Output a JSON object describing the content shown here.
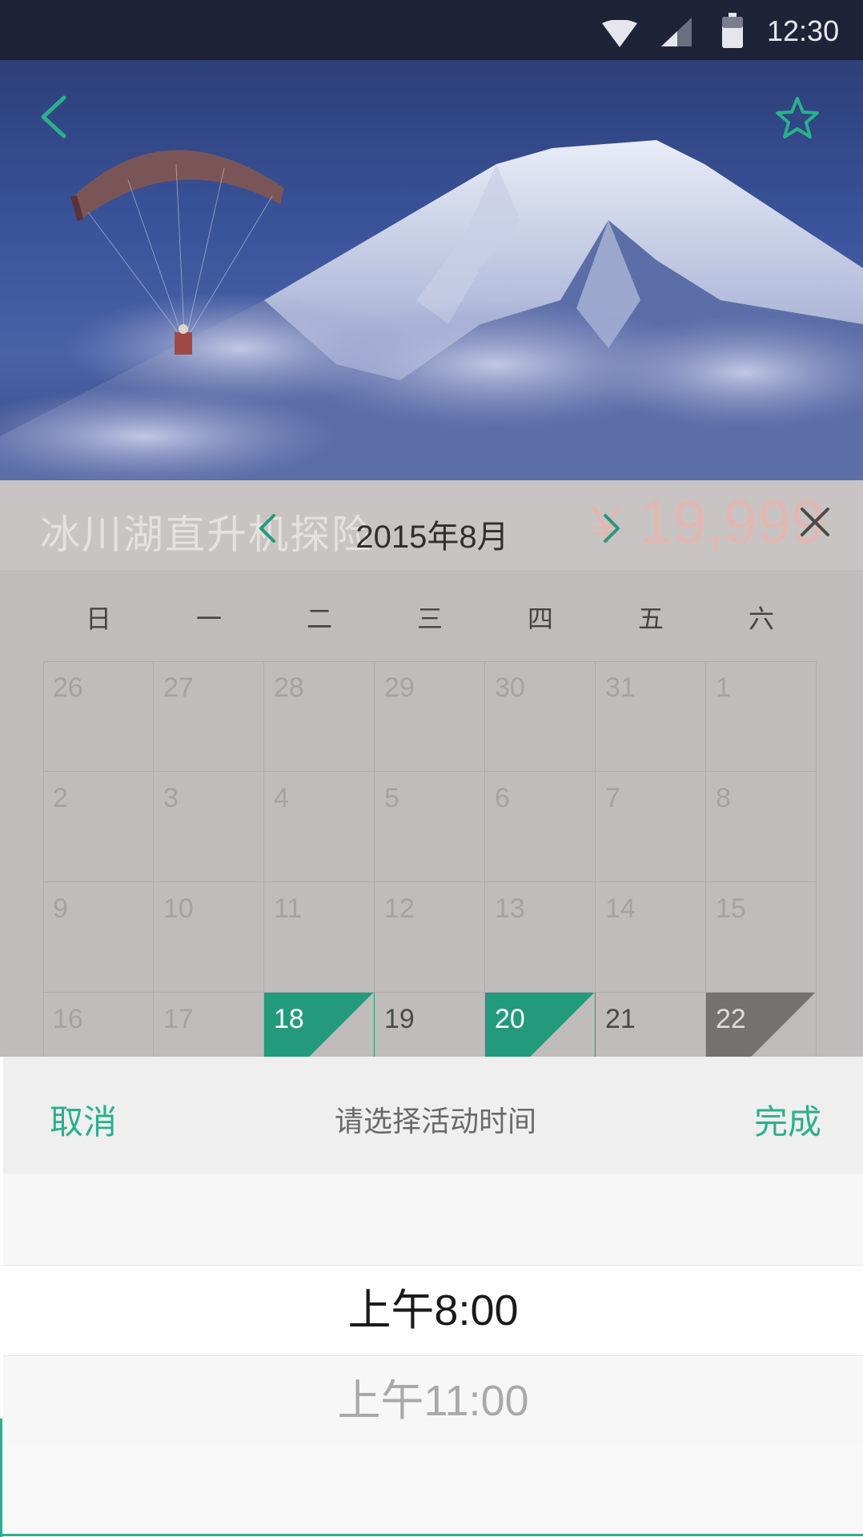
{
  "status_bar": {
    "time": "12:30",
    "icons": [
      "wifi-icon",
      "cell-signal-icon",
      "battery-icon"
    ]
  },
  "header": {
    "back_icon": "chevron-left-icon",
    "favorite_icon": "star-icon"
  },
  "activity": {
    "title": "冰川湖直升机探险",
    "currency": "￥",
    "price": "19,999"
  },
  "calendar": {
    "month_label": "2015年8月",
    "prev_icon": "chevron-left-icon",
    "next_icon": "chevron-right-icon",
    "close_icon": "close-icon",
    "weekdays": [
      "日",
      "一",
      "二",
      "三",
      "四",
      "五",
      "六"
    ],
    "weeks": [
      [
        {
          "d": "26",
          "s": "disabled"
        },
        {
          "d": "27",
          "s": "disabled"
        },
        {
          "d": "28",
          "s": "disabled"
        },
        {
          "d": "29",
          "s": "disabled"
        },
        {
          "d": "30",
          "s": "disabled"
        },
        {
          "d": "31",
          "s": "disabled"
        },
        {
          "d": "1",
          "s": "disabled"
        }
      ],
      [
        {
          "d": "2",
          "s": "disabled"
        },
        {
          "d": "3",
          "s": "disabled"
        },
        {
          "d": "4",
          "s": "disabled"
        },
        {
          "d": "5",
          "s": "disabled"
        },
        {
          "d": "6",
          "s": "disabled"
        },
        {
          "d": "7",
          "s": "disabled"
        },
        {
          "d": "8",
          "s": "disabled"
        }
      ],
      [
        {
          "d": "9",
          "s": "disabled"
        },
        {
          "d": "10",
          "s": "disabled"
        },
        {
          "d": "11",
          "s": "disabled"
        },
        {
          "d": "12",
          "s": "disabled"
        },
        {
          "d": "13",
          "s": "disabled"
        },
        {
          "d": "14",
          "s": "disabled"
        },
        {
          "d": "15",
          "s": "disabled"
        }
      ],
      [
        {
          "d": "16",
          "s": "disabled"
        },
        {
          "d": "17",
          "s": "disabled"
        },
        {
          "d": "18",
          "s": "selected"
        },
        {
          "d": "19",
          "s": "available"
        },
        {
          "d": "20",
          "s": "selected"
        },
        {
          "d": "21",
          "s": "available"
        },
        {
          "d": "22",
          "s": "full"
        }
      ]
    ],
    "colors": {
      "selected": "#239a7c",
      "full": "#767171"
    }
  },
  "time_picker": {
    "cancel_label": "取消",
    "title": "请选择活动时间",
    "done_label": "完成",
    "options": [
      "上午8:00",
      "上午11:00"
    ],
    "selected_index": 0,
    "accent_color": "#2ab08d"
  }
}
